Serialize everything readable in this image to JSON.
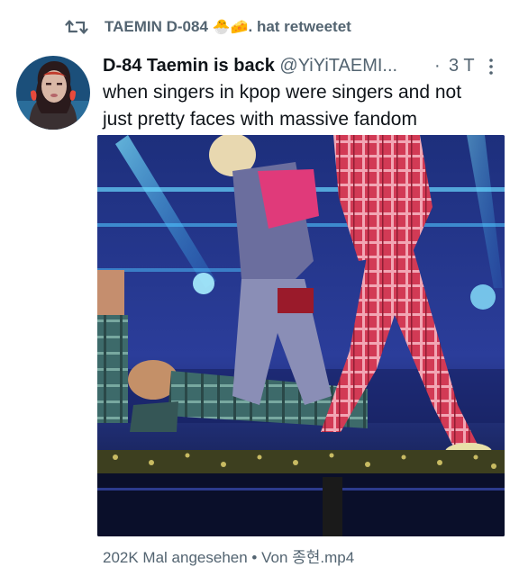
{
  "retweet": {
    "label": "TAEMIN D-084",
    "emoji": "🐣🧀",
    "suffix": ". hat retweetet"
  },
  "tweet": {
    "display_name": "D-84 Taemin is back",
    "handle": "@YiYiTAEMI...",
    "separator": "·",
    "time": "3 T",
    "text_lines": [
      "when singers in kpop were singers and not",
      "just pretty faces with massive fandom"
    ]
  },
  "media": {
    "type": "video",
    "icon": "video-thumbnail"
  },
  "footer": {
    "views": "202K Mal angesehen",
    "separator": "•",
    "source": "Von 종현.mp4"
  },
  "icons": {
    "retweet": "retweet-icon",
    "more": "more-options-icon"
  },
  "colors": {
    "text_primary": "#0f1419",
    "text_secondary": "#536471"
  }
}
